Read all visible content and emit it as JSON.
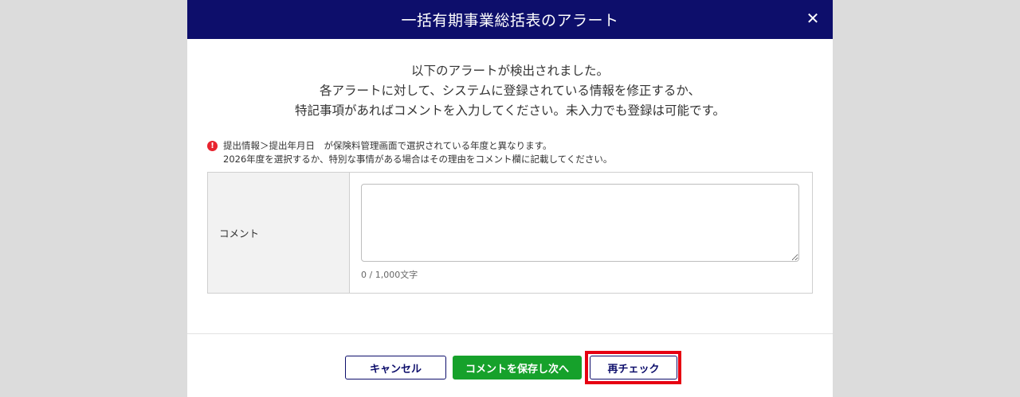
{
  "colors": {
    "header_bg": "#0d0e6b",
    "backdrop": "#dcdcdc",
    "alert_red": "#e8232e",
    "save_green": "#16a12b",
    "highlight_red": "#e60012"
  },
  "modal": {
    "title": "一括有期事業総括表のアラート",
    "close_icon": "close-icon",
    "intro": {
      "line1": "以下のアラートが検出されました。",
      "line2": "各アラートに対して、システムに登録されている情報を修正するか、",
      "line3": "特記事項があればコメントを入力してください。未入力でも登録は可能です。"
    },
    "alert": {
      "icon": "exclamation-circle-icon",
      "icon_glyph": "!",
      "line1": "提出情報＞提出年月日　が保険料管理画面で選択されている年度と異なります。",
      "line2": "2026年度を選択するか、特別な事情がある場合はその理由をコメント欄に記載してください。"
    },
    "comment": {
      "label": "コメント",
      "value": "",
      "counter": "0 / 1,000文字"
    },
    "buttons": {
      "cancel": "キャンセル",
      "save_next": "コメントを保存し次へ",
      "recheck": "再チェック"
    }
  }
}
